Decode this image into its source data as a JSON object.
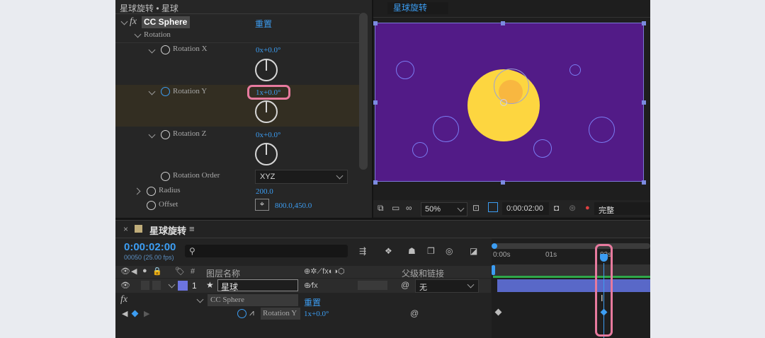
{
  "effect_controls": {
    "title": "星球旋转 • 星球",
    "fx_label": "fx",
    "effect_name": "CC Sphere",
    "reset": "重置",
    "group_rotation": "Rotation",
    "rotation_x": {
      "label": "Rotation X",
      "value": "0x+0.0°"
    },
    "rotation_y": {
      "label": "Rotation Y",
      "value": "1x+0.0°"
    },
    "rotation_z": {
      "label": "Rotation Z",
      "value": "0x+0.0°"
    },
    "rotation_order": {
      "label": "Rotation Order",
      "value": "XYZ"
    },
    "radius": {
      "label": "Radius",
      "value": "200.0"
    },
    "offset": {
      "label": "Offset",
      "value": "800.0,450.0"
    }
  },
  "composition": {
    "tab": "星球旋转",
    "zoom": "50%",
    "timecode": "0:00:02:00",
    "resolution": "完整",
    "canvas_color": "#521b87",
    "planet_color": "#fdd640"
  },
  "timeline": {
    "close": "×",
    "comp_name": "星球旋转",
    "menu": "≡",
    "timecode": "0:00:02:00",
    "frames": "00050 (25.00 fps)",
    "search_placeholder": "",
    "col_num": "#",
    "col_layer_name": "图层名称",
    "col_parent": "父级和链接",
    "ruler": [
      "0:00s",
      "01s",
      "02s"
    ],
    "layer": {
      "index": "1",
      "name": "星球",
      "parent": "无"
    },
    "effect_row": {
      "fx": "fx",
      "name": "CC Sphere",
      "reset": "重置"
    },
    "prop_row": {
      "name": "Rotation Y",
      "value": "1x+0.0°"
    }
  },
  "colors": {
    "accent": "#3c9df2",
    "highlight": "#e77a9e"
  }
}
